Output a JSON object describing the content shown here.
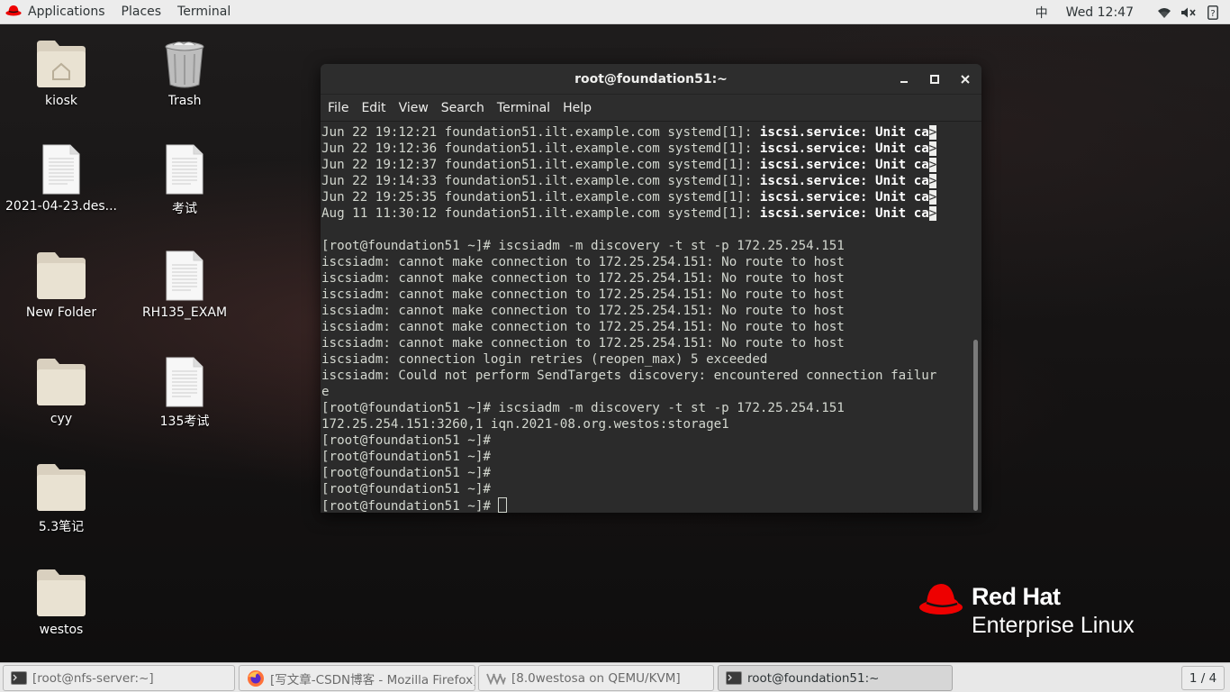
{
  "top_bar": {
    "applications": "Applications",
    "places": "Places",
    "terminal": "Terminal",
    "ime": "中",
    "clock": "Wed 12:47"
  },
  "desktop_icons": [
    {
      "label": "kiosk",
      "icon": "home-folder-icon"
    },
    {
      "label": "Trash",
      "icon": "trash-icon"
    },
    {
      "label": "2021-04-23.des...",
      "icon": "document-icon"
    },
    {
      "label": "考试",
      "icon": "document-icon"
    },
    {
      "label": "New Folder",
      "icon": "folder-icon"
    },
    {
      "label": "RH135_EXAM",
      "icon": "document-icon"
    },
    {
      "label": "cyy",
      "icon": "folder-icon"
    },
    {
      "label": "135考试",
      "icon": "document-icon"
    },
    {
      "label": "5.3笔记",
      "icon": "folder-icon"
    },
    {
      "label": "westos",
      "icon": "folder-icon"
    }
  ],
  "terminal": {
    "title": "root@foundation51:~",
    "menu": [
      "File",
      "Edit",
      "View",
      "Search",
      "Terminal",
      "Help"
    ],
    "log_lines": [
      {
        "prefix": "Jun 22 19:12:21 foundation51.ilt.example.com systemd[1]: ",
        "bold": "iscsi.service: Unit ca"
      },
      {
        "prefix": "Jun 22 19:12:36 foundation51.ilt.example.com systemd[1]: ",
        "bold": "iscsi.service: Unit ca"
      },
      {
        "prefix": "Jun 22 19:12:37 foundation51.ilt.example.com systemd[1]: ",
        "bold": "iscsi.service: Unit ca"
      },
      {
        "prefix": "Jun 22 19:14:33 foundation51.ilt.example.com systemd[1]: ",
        "bold": "iscsi.service: Unit ca"
      },
      {
        "prefix": "Jun 22 19:25:35 foundation51.ilt.example.com systemd[1]: ",
        "bold": "iscsi.service: Unit ca"
      },
      {
        "prefix": "Aug 11 11:30:12 foundation51.ilt.example.com systemd[1]: ",
        "bold": "iscsi.service: Unit ca"
      }
    ],
    "truncation_marker": ">",
    "output_lines": [
      "",
      "[root@foundation51 ~]# iscsiadm -m discovery -t st -p 172.25.254.151",
      "iscsiadm: cannot make connection to 172.25.254.151: No route to host",
      "iscsiadm: cannot make connection to 172.25.254.151: No route to host",
      "iscsiadm: cannot make connection to 172.25.254.151: No route to host",
      "iscsiadm: cannot make connection to 172.25.254.151: No route to host",
      "iscsiadm: cannot make connection to 172.25.254.151: No route to host",
      "iscsiadm: cannot make connection to 172.25.254.151: No route to host",
      "iscsiadm: connection login retries (reopen_max) 5 exceeded",
      "iscsiadm: Could not perform SendTargets discovery: encountered connection failur",
      "e",
      "[root@foundation51 ~]# iscsiadm -m discovery -t st -p 172.25.254.151",
      "172.25.254.151:3260,1 iqn.2021-08.org.westos:storage1",
      "[root@foundation51 ~]#",
      "[root@foundation51 ~]#",
      "[root@foundation51 ~]#",
      "[root@foundation51 ~]#"
    ],
    "prompt_line": "[root@foundation51 ~]# "
  },
  "branding": {
    "line1": "Red Hat",
    "line2": "Enterprise Linux"
  },
  "taskbar": {
    "tasks": [
      {
        "label": "[root@nfs-server:~]",
        "icon": "terminal-icon"
      },
      {
        "label": "[写文章-CSDN博客 - Mozilla Firefox]",
        "icon": "firefox-icon"
      },
      {
        "label": "[8.0westosa on QEMU/KVM]",
        "icon": "virt-manager-icon"
      },
      {
        "label": "root@foundation51:~",
        "icon": "terminal-icon"
      }
    ],
    "workspace": "1 / 4"
  },
  "colors": {
    "redhat_red": "#ee0000",
    "terminal_bg": "#2b2b2b",
    "terminal_fg": "#d3d7cf"
  }
}
